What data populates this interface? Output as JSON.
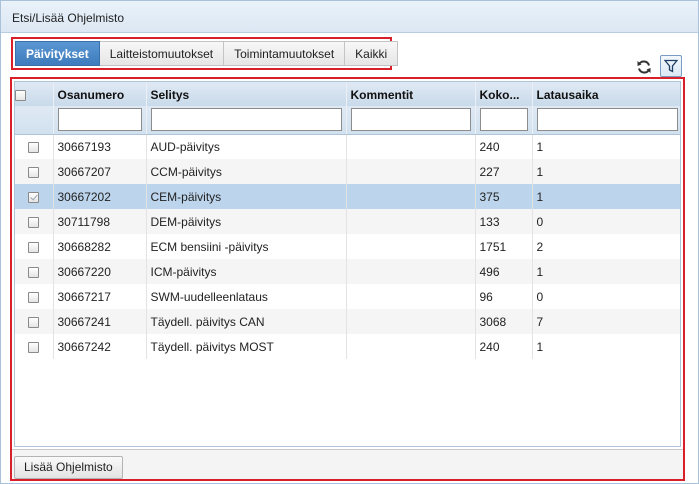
{
  "window": {
    "title": "Etsi/Lisää Ohjelmisto"
  },
  "tabs": [
    {
      "label": "Päivitykset",
      "active": true
    },
    {
      "label": "Laitteistomuutokset",
      "active": false
    },
    {
      "label": "Toimintamuutokset",
      "active": false
    },
    {
      "label": "Kaikki",
      "active": false
    }
  ],
  "toolbar": {
    "refresh_icon": "refresh-icon",
    "filter_icon": "funnel-icon"
  },
  "columns": [
    "Osanumero",
    "Selitys",
    "Kommentit",
    "Koko...",
    "Latausaika"
  ],
  "rows": [
    {
      "part": "30667193",
      "desc": "AUD-päivitys",
      "comment": "",
      "size": "240",
      "time": "1",
      "checked": false,
      "selected": false
    },
    {
      "part": "30667207",
      "desc": "CCM-päivitys",
      "comment": "",
      "size": "227",
      "time": "1",
      "checked": false,
      "selected": false
    },
    {
      "part": "30667202",
      "desc": "CEM-päivitys",
      "comment": "",
      "size": "375",
      "time": "1",
      "checked": true,
      "selected": true
    },
    {
      "part": "30711798",
      "desc": "DEM-päivitys",
      "comment": "",
      "size": "133",
      "time": "0",
      "checked": false,
      "selected": false
    },
    {
      "part": "30668282",
      "desc": "ECM bensiini -päivitys",
      "comment": "",
      "size": "1751",
      "time": "2",
      "checked": false,
      "selected": false
    },
    {
      "part": "30667220",
      "desc": "ICM-päivitys",
      "comment": "",
      "size": "496",
      "time": "1",
      "checked": false,
      "selected": false
    },
    {
      "part": "30667217",
      "desc": "SWM-uudelleenlataus",
      "comment": "",
      "size": "96",
      "time": "0",
      "checked": false,
      "selected": false
    },
    {
      "part": "30667241",
      "desc": "Täydell. päivitys CAN",
      "comment": "",
      "size": "3068",
      "time": "7",
      "checked": false,
      "selected": false
    },
    {
      "part": "30667242",
      "desc": "Täydell. päivitys MOST",
      "comment": "",
      "size": "240",
      "time": "1",
      "checked": false,
      "selected": false
    }
  ],
  "footer": {
    "add_label": "Lisää Ohjelmisto"
  },
  "colors": {
    "accent": "#3d7bbd",
    "highlight": "#d9202a",
    "selected_row": "#bcd4ec"
  }
}
